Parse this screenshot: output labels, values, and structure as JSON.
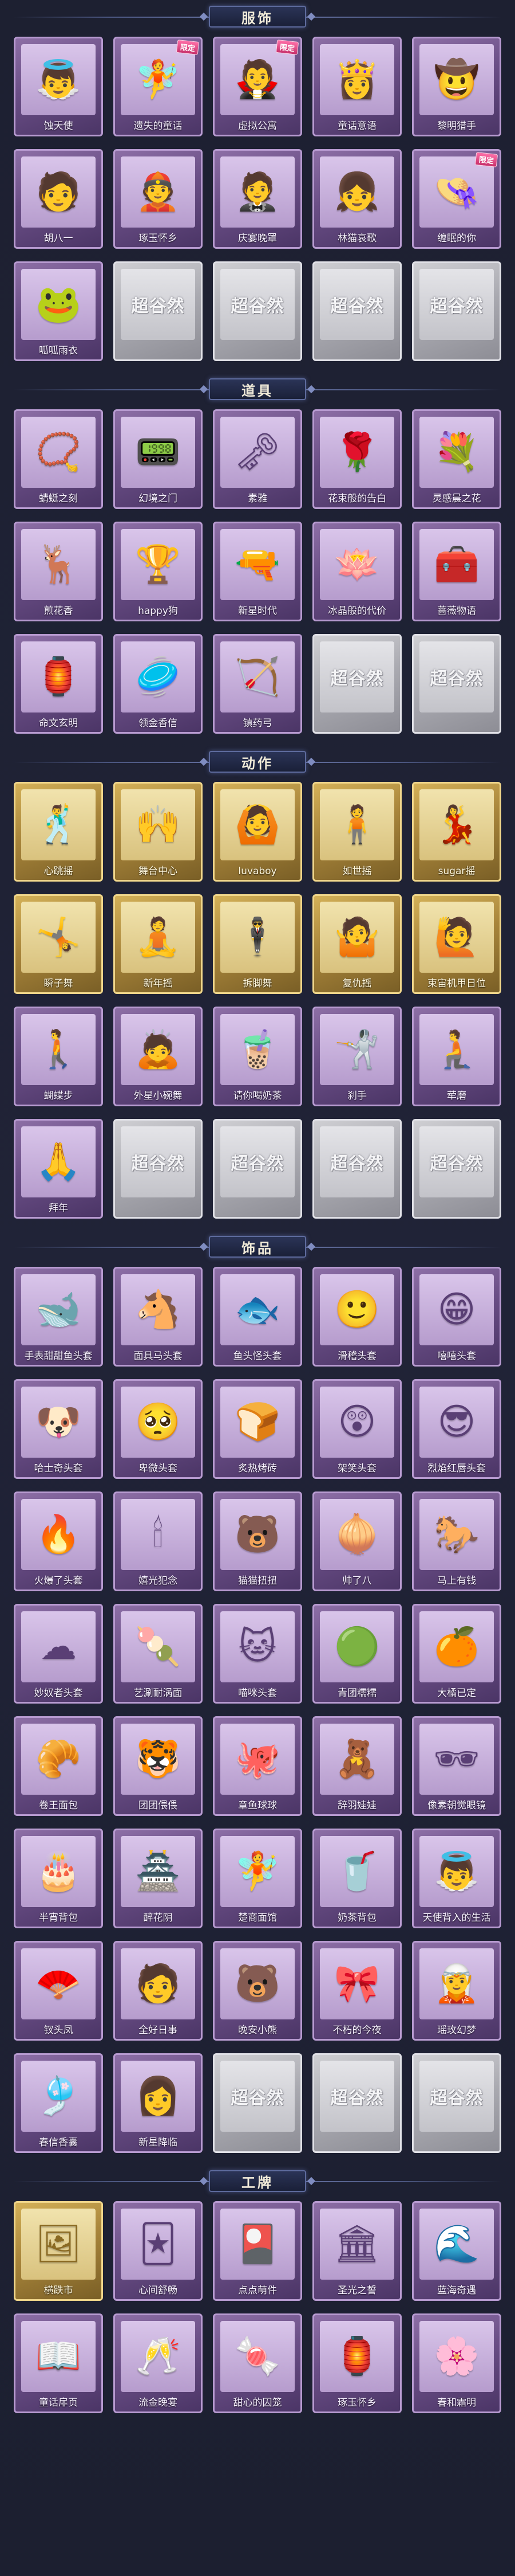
{
  "placeholder_text": "超谷然",
  "sections": [
    {
      "id": "clothing",
      "title": "服饰",
      "items": [
        {
          "name": "蚀天使",
          "icon": "costume-portrait-icon",
          "glyph": "👼",
          "rarity": "purple"
        },
        {
          "name": "遗失的童话",
          "icon": "costume-portrait-icon",
          "glyph": "🧚",
          "rarity": "purple",
          "badge": "限定"
        },
        {
          "name": "虚拟公寓",
          "icon": "costume-portrait-icon",
          "glyph": "🧛",
          "rarity": "purple",
          "badge": "限定"
        },
        {
          "name": "童话意语",
          "icon": "costume-portrait-icon",
          "glyph": "👸",
          "rarity": "purple"
        },
        {
          "name": "黎明猎手",
          "icon": "costume-portrait-icon",
          "glyph": "🤠",
          "rarity": "purple"
        },
        {
          "name": "胡八一",
          "icon": "costume-portrait-icon",
          "glyph": "🧑",
          "rarity": "purple"
        },
        {
          "name": "琢玉怀乡",
          "icon": "costume-portrait-icon",
          "glyph": "👲",
          "rarity": "purple"
        },
        {
          "name": "庆宴晚罩",
          "icon": "costume-portrait-icon",
          "glyph": "🤵",
          "rarity": "purple"
        },
        {
          "name": "林猫哀歌",
          "icon": "costume-portrait-icon",
          "glyph": "👧",
          "rarity": "purple"
        },
        {
          "name": "缠眠的你",
          "icon": "costume-portrait-icon",
          "glyph": "👒",
          "rarity": "purple",
          "badge": "限定"
        },
        {
          "name": "呱呱雨衣",
          "icon": "costume-portrait-icon",
          "glyph": "🐸",
          "rarity": "purple"
        },
        {
          "empty": true
        },
        {
          "empty": true
        },
        {
          "empty": true
        },
        {
          "empty": true
        }
      ]
    },
    {
      "id": "props",
      "title": "道具",
      "items": [
        {
          "name": "蜻蜓之刻",
          "icon": "necklace-icon",
          "glyph": "📿",
          "rarity": "purple"
        },
        {
          "name": "幻境之门",
          "icon": "device-icon",
          "glyph": "📟",
          "rarity": "purple"
        },
        {
          "name": "素雅",
          "icon": "pendant-icon",
          "glyph": "🗝",
          "rarity": "purple"
        },
        {
          "name": "花束般的告白",
          "icon": "rose-icon",
          "glyph": "🌹",
          "rarity": "purple"
        },
        {
          "name": "灵感晨之花",
          "icon": "bouquet-icon",
          "glyph": "💐",
          "rarity": "purple"
        },
        {
          "name": "煎花香",
          "icon": "antler-icon",
          "glyph": "🦌",
          "rarity": "purple"
        },
        {
          "name": "happy狗",
          "icon": "trophy-icon",
          "glyph": "🏆",
          "rarity": "purple"
        },
        {
          "name": "新星时代",
          "icon": "revolver-icon",
          "glyph": "🔫",
          "rarity": "purple"
        },
        {
          "name": "冰晶般的代价",
          "icon": "lotus-icon",
          "glyph": "🪷",
          "rarity": "purple"
        },
        {
          "name": "蔷薇物语",
          "icon": "medkit-icon",
          "glyph": "🧰",
          "rarity": "purple"
        },
        {
          "name": "命文玄明",
          "icon": "lantern-icon",
          "glyph": "🏮",
          "rarity": "purple"
        },
        {
          "name": "领金香信",
          "icon": "disc-icon",
          "glyph": "🥏",
          "rarity": "purple"
        },
        {
          "name": "镇药弓",
          "icon": "bow-icon",
          "glyph": "🏹",
          "rarity": "purple"
        },
        {
          "empty": true
        },
        {
          "empty": true
        }
      ]
    },
    {
      "id": "actions",
      "title": "动作",
      "items": [
        {
          "name": "心跳摇",
          "icon": "pose-figure-icon",
          "glyph": "🕺",
          "rarity": "gold"
        },
        {
          "name": "舞台中心",
          "icon": "pose-figure-icon",
          "glyph": "🙌",
          "rarity": "gold"
        },
        {
          "name": "luvaboy",
          "icon": "pose-figure-icon",
          "glyph": "🙆",
          "rarity": "gold"
        },
        {
          "name": "如世摇",
          "icon": "pose-figure-icon",
          "glyph": "🧍",
          "rarity": "gold"
        },
        {
          "name": "sugar摇",
          "icon": "pose-figure-icon",
          "glyph": "💃",
          "rarity": "gold"
        },
        {
          "name": "瞬子舞",
          "icon": "pose-figure-icon",
          "glyph": "🤸",
          "rarity": "gold"
        },
        {
          "name": "新年摇",
          "icon": "pose-figure-icon",
          "glyph": "🧘",
          "rarity": "gold"
        },
        {
          "name": "拆脚舞",
          "icon": "pose-figure-icon",
          "glyph": "🕴",
          "rarity": "gold"
        },
        {
          "name": "复仇摇",
          "icon": "pose-figure-icon",
          "glyph": "🤷",
          "rarity": "gold"
        },
        {
          "name": "束宙机甲日位",
          "icon": "pose-figure-icon",
          "glyph": "🙋",
          "rarity": "gold"
        },
        {
          "name": "蝴蝶步",
          "icon": "pose-figure-icon",
          "glyph": "🚶",
          "rarity": "purple"
        },
        {
          "name": "外星小碗舞",
          "icon": "pose-figure-icon",
          "glyph": "🙇",
          "rarity": "purple"
        },
        {
          "name": "请你喝奶茶",
          "icon": "pose-figure-icon",
          "glyph": "🧋",
          "rarity": "purple"
        },
        {
          "name": "刹手",
          "icon": "pose-figure-icon",
          "glyph": "🤺",
          "rarity": "purple"
        },
        {
          "name": "荦磨",
          "icon": "pose-figure-icon",
          "glyph": "🧎",
          "rarity": "purple"
        },
        {
          "name": "拜年",
          "icon": "pose-figure-icon",
          "glyph": "🙏",
          "rarity": "purple"
        },
        {
          "empty": true
        },
        {
          "empty": true
        },
        {
          "empty": true
        },
        {
          "empty": true
        }
      ]
    },
    {
      "id": "accessories",
      "title": "饰品",
      "items": [
        {
          "name": "手表甜甜鱼头套",
          "icon": "mask-head-icon",
          "glyph": "🐋",
          "rarity": "purple"
        },
        {
          "name": "面具马头套",
          "icon": "mask-head-icon",
          "glyph": "🐴",
          "rarity": "purple"
        },
        {
          "name": "鱼头怪头套",
          "icon": "mask-head-icon",
          "glyph": "🐟",
          "rarity": "purple"
        },
        {
          "name": "滑稽头套",
          "icon": "mask-head-icon",
          "glyph": "🙂",
          "rarity": "purple"
        },
        {
          "name": "嘻嘻头套",
          "icon": "mask-head-icon",
          "glyph": "😁",
          "rarity": "purple"
        },
        {
          "name": "哈士奇头套",
          "icon": "mask-head-icon",
          "glyph": "🐶",
          "rarity": "purple"
        },
        {
          "name": "卑微头套",
          "icon": "mask-head-icon",
          "glyph": "🥺",
          "rarity": "purple"
        },
        {
          "name": "炙热烤砖",
          "icon": "mask-head-icon",
          "glyph": "🍞",
          "rarity": "purple"
        },
        {
          "name": "架笑头套",
          "icon": "mask-head-icon",
          "glyph": "😲",
          "rarity": "purple"
        },
        {
          "name": "烈焰红唇头套",
          "icon": "mask-head-icon",
          "glyph": "😎",
          "rarity": "purple"
        },
        {
          "name": "火爆了头套",
          "icon": "mask-head-icon",
          "glyph": "🔥",
          "rarity": "purple"
        },
        {
          "name": "嬉光犯念",
          "icon": "mask-head-icon",
          "glyph": "🕯",
          "rarity": "purple"
        },
        {
          "name": "猫猫扭扭",
          "icon": "mask-head-icon",
          "glyph": "🐻",
          "rarity": "purple"
        },
        {
          "name": "帅了八",
          "icon": "mask-head-icon",
          "glyph": "🧅",
          "rarity": "purple"
        },
        {
          "name": "马上有钱",
          "icon": "mask-head-icon",
          "glyph": "🐎",
          "rarity": "purple"
        },
        {
          "name": "妙奴者头套",
          "icon": "mask-head-icon",
          "glyph": "☁",
          "rarity": "purple"
        },
        {
          "name": "艺涮耐涡面",
          "icon": "mask-head-icon",
          "glyph": "🍡",
          "rarity": "purple"
        },
        {
          "name": "喵咪头套",
          "icon": "mask-head-icon",
          "glyph": "🐱",
          "rarity": "purple"
        },
        {
          "name": "青团糯糯",
          "icon": "mask-head-icon",
          "glyph": "🟢",
          "rarity": "purple"
        },
        {
          "name": "大橘已定",
          "icon": "mask-head-icon",
          "glyph": "🍊",
          "rarity": "purple"
        },
        {
          "name": "卷王面包",
          "icon": "mask-head-icon",
          "glyph": "🥐",
          "rarity": "purple"
        },
        {
          "name": "团团偎偎",
          "icon": "mask-head-icon",
          "glyph": "🐯",
          "rarity": "purple"
        },
        {
          "name": "章鱼球球",
          "icon": "mask-head-icon",
          "glyph": "🐙",
          "rarity": "purple"
        },
        {
          "name": "辞羽娃娃",
          "icon": "mask-head-icon",
          "glyph": "🧸",
          "rarity": "purple"
        },
        {
          "name": "像素朝觉眼镜",
          "icon": "sunglasses-icon",
          "glyph": "🕶",
          "rarity": "purple"
        },
        {
          "name": "半宵背包",
          "icon": "backpack-icon",
          "glyph": "🎂",
          "rarity": "purple"
        },
        {
          "name": "醉花阴",
          "icon": "backpack-icon",
          "glyph": "🏯",
          "rarity": "purple"
        },
        {
          "name": "楚商面馆",
          "icon": "backpack-icon",
          "glyph": "🧚",
          "rarity": "purple"
        },
        {
          "name": "奶茶背包",
          "icon": "backpack-icon",
          "glyph": "🥤",
          "rarity": "purple"
        },
        {
          "name": "天使背入的生活",
          "icon": "backpack-icon",
          "glyph": "👼",
          "rarity": "purple"
        },
        {
          "name": "钗头凤",
          "icon": "charm-icon",
          "glyph": "🪭",
          "rarity": "purple"
        },
        {
          "name": "全好日事",
          "icon": "charm-icon",
          "glyph": "🧑",
          "rarity": "purple"
        },
        {
          "name": "晚安小熊",
          "icon": "charm-icon",
          "glyph": "🐻",
          "rarity": "purple"
        },
        {
          "name": "不朽的今夜",
          "icon": "charm-icon",
          "glyph": "🎀",
          "rarity": "purple"
        },
        {
          "name": "瑶玫幻梦",
          "icon": "charm-icon",
          "glyph": "🧝",
          "rarity": "purple"
        },
        {
          "name": "春信香囊",
          "icon": "charm-icon",
          "glyph": "🎐",
          "rarity": "purple"
        },
        {
          "name": "新星降临",
          "icon": "charm-icon",
          "glyph": "👩",
          "rarity": "purple"
        },
        {
          "empty": true
        },
        {
          "empty": true
        },
        {
          "empty": true
        }
      ]
    },
    {
      "id": "cards",
      "title": "工牌",
      "items": [
        {
          "name": "横跌市",
          "icon": "badge-card-icon",
          "glyph": "🖼",
          "rarity": "gold"
        },
        {
          "name": "心间舒畅",
          "icon": "badge-card-icon",
          "glyph": "🃏",
          "rarity": "purple"
        },
        {
          "name": "点点萌件",
          "icon": "badge-card-icon",
          "glyph": "🎴",
          "rarity": "purple"
        },
        {
          "name": "圣光之誓",
          "icon": "badge-card-icon",
          "glyph": "🏛",
          "rarity": "purple"
        },
        {
          "name": "蓝海奇遇",
          "icon": "badge-card-icon",
          "glyph": "🌊",
          "rarity": "purple"
        },
        {
          "name": "童话扉页",
          "icon": "badge-card-icon",
          "glyph": "📖",
          "rarity": "purple"
        },
        {
          "name": "流金晚宴",
          "icon": "badge-card-icon",
          "glyph": "🥂",
          "rarity": "purple"
        },
        {
          "name": "甜心的囚笼",
          "icon": "badge-card-icon",
          "glyph": "🍬",
          "rarity": "purple"
        },
        {
          "name": "琢玉怀乡",
          "icon": "badge-card-icon",
          "glyph": "🏮",
          "rarity": "purple"
        },
        {
          "name": "春和霜明",
          "icon": "badge-card-icon",
          "glyph": "🌸",
          "rarity": "purple"
        }
      ]
    }
  ]
}
